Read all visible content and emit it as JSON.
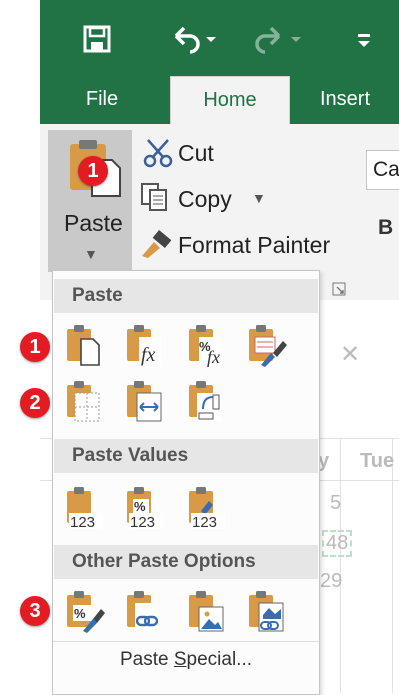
{
  "quick_access": {
    "save_icon": "save-icon",
    "undo_icon": "undo-icon",
    "redo_icon": "redo-icon",
    "customize_icon": "customize-qat-icon"
  },
  "tabs": [
    {
      "label": "File",
      "active": false
    },
    {
      "label": "Home",
      "active": true
    },
    {
      "label": "Insert",
      "active": false
    }
  ],
  "ribbon": {
    "paste_label": "Paste",
    "cut_label": "Cut",
    "copy_label": "Copy",
    "format_painter_label": "Format Painter",
    "font_name_partial": "Ca",
    "bold_label": "B"
  },
  "sheet": {
    "col_partial_1": "y",
    "col_partial_2": "Tue",
    "values": [
      "5",
      "48",
      "29"
    ]
  },
  "menu": {
    "sections": [
      {
        "title": "Paste"
      },
      {
        "title": "Paste Values"
      },
      {
        "title": "Other Paste Options"
      }
    ],
    "paste_special_prefix": "Paste ",
    "paste_special_underlined": "S",
    "paste_special_suffix": "pecial..."
  },
  "markers": [
    "1",
    "1",
    "2",
    "3"
  ],
  "colors": {
    "excel_green": "#217346",
    "marker_red": "#e31b23",
    "clipboard_orange": "#d99a48"
  }
}
